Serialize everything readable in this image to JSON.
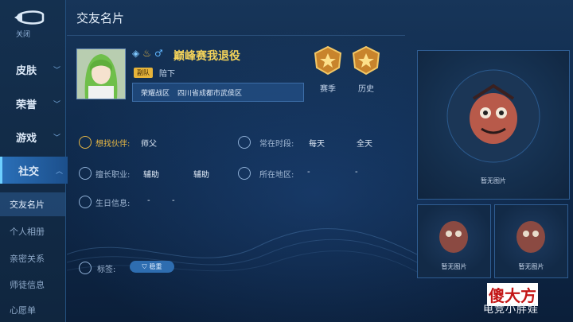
{
  "header": {
    "title": "交友名片",
    "back_label": "关闭"
  },
  "sidebar": {
    "main_items": [
      {
        "label": "皮肤",
        "chevron": "﹀"
      },
      {
        "label": "荣誉",
        "chevron": "﹀"
      },
      {
        "label": "游戏",
        "chevron": "﹀"
      },
      {
        "label": "社交",
        "chevron": "︿"
      }
    ],
    "sub_items": [
      {
        "label": "交友名片"
      },
      {
        "label": "个人相册"
      },
      {
        "label": "亲密关系"
      },
      {
        "label": "师徒信息"
      },
      {
        "label": "心愿单"
      }
    ]
  },
  "profile": {
    "username": "巅峰赛我退役",
    "role_badge": "副队",
    "role_text": "陪下",
    "region_server": "荣耀战区",
    "region_location": "四川省成都市武侯区",
    "medals": [
      {
        "label": "赛季"
      },
      {
        "label": "历史"
      }
    ]
  },
  "info": {
    "partner_label": "想找伙伴:",
    "partner_value": "师父",
    "time_label": "常在时段:",
    "time_day": "每天",
    "time_range": "全天",
    "job_label": "擅长职业:",
    "job_value1": "辅助",
    "job_value2": "辅助",
    "location_label": "所在地区:",
    "location_value1": "-",
    "location_value2": "-",
    "birthday_label": "生日信息:",
    "birthday_value1": "-",
    "birthday_value2": "-",
    "tags_label": "标签:",
    "tag_value": "稳重"
  },
  "photos": {
    "main_caption": "暂无图片",
    "small_captions": [
      "暂无图片",
      "暂无图片"
    ]
  },
  "watermark": {
    "line1": "傻大方",
    "line2": "电竞小胖娃"
  },
  "colors": {
    "accent": "#2a6fb7",
    "gold": "#e8b844",
    "username": "#f3d35a"
  }
}
